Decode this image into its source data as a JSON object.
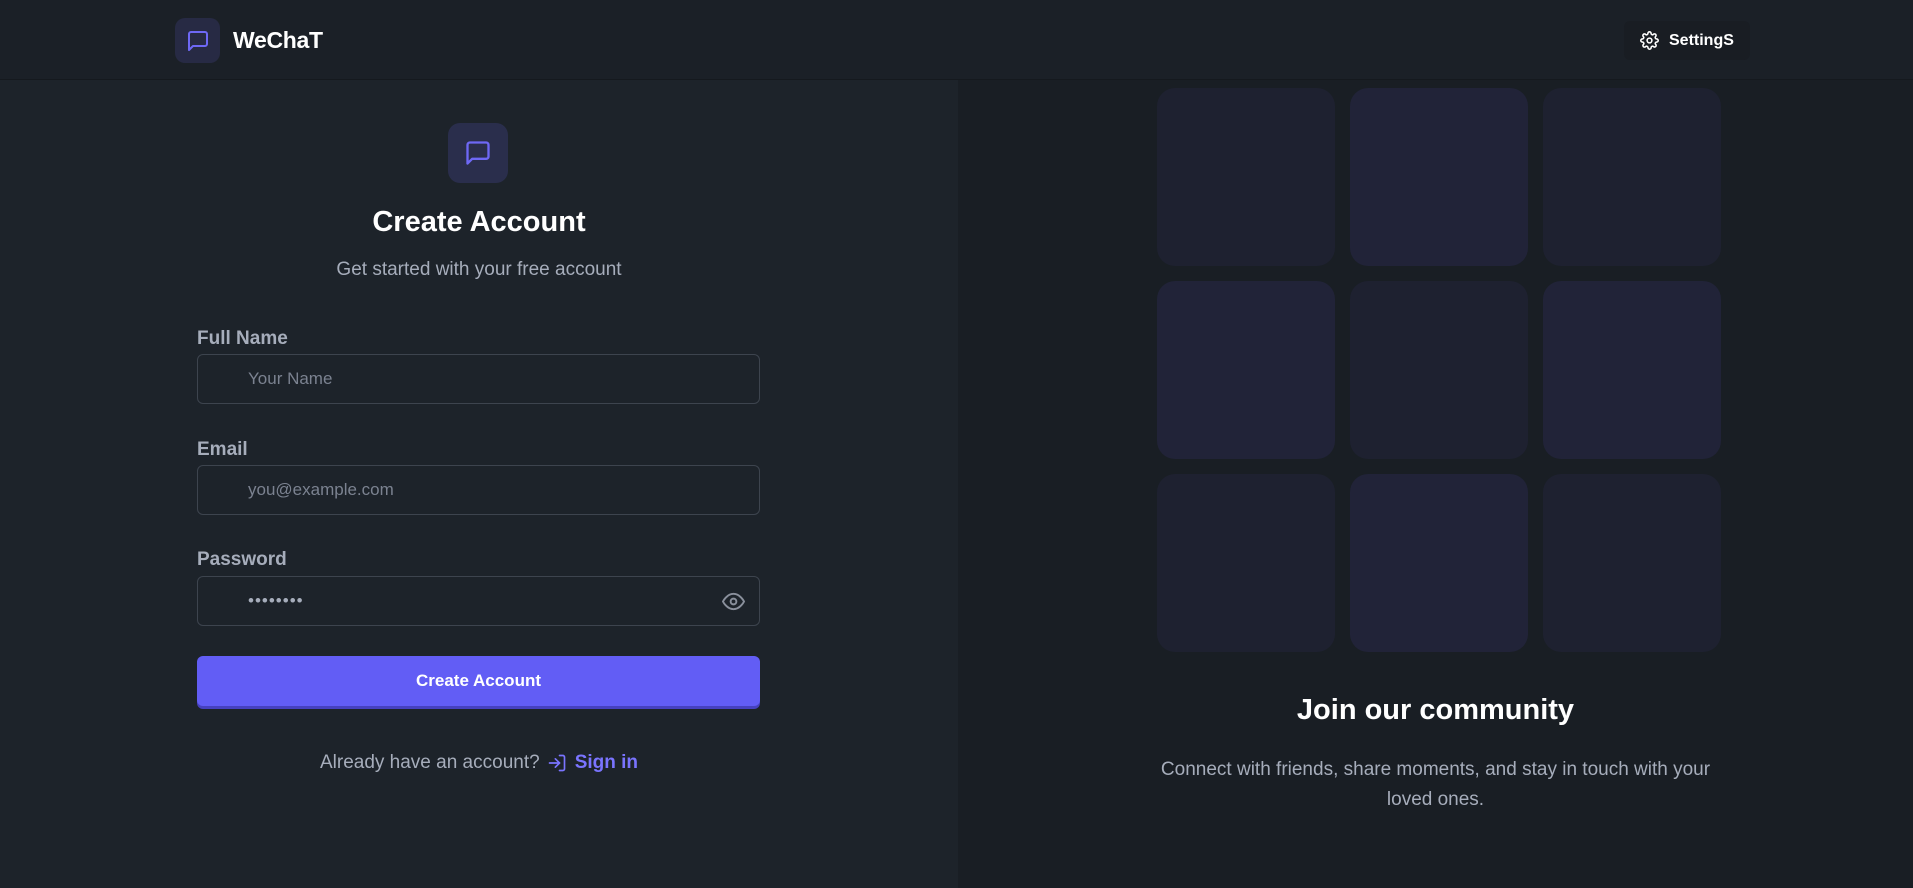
{
  "header": {
    "brand": "WeChaT",
    "settings_label": "SettingS"
  },
  "form": {
    "title": "Create Account",
    "subtitle": "Get started with your free account",
    "full_name": {
      "label": "Full Name",
      "placeholder": "Your Name",
      "value": ""
    },
    "email": {
      "label": "Email",
      "placeholder": "you@example.com",
      "value": ""
    },
    "password": {
      "label": "Password",
      "value_masked": "••••••••"
    },
    "submit_label": "Create Account",
    "signin_prompt": "Already have an account?",
    "signin_link": "Sign in"
  },
  "promo": {
    "title": "Join our community",
    "text": "Connect with friends, share moments, and stay in touch with your loved ones."
  },
  "icons": {
    "logo": "message-square-icon",
    "settings": "gear-icon",
    "password_toggle": "eye-icon",
    "signin": "log-in-icon"
  },
  "colors": {
    "accent": "#625df5",
    "link": "#7a74ff",
    "background_left": "#1d232a",
    "background_right": "#191e24"
  }
}
